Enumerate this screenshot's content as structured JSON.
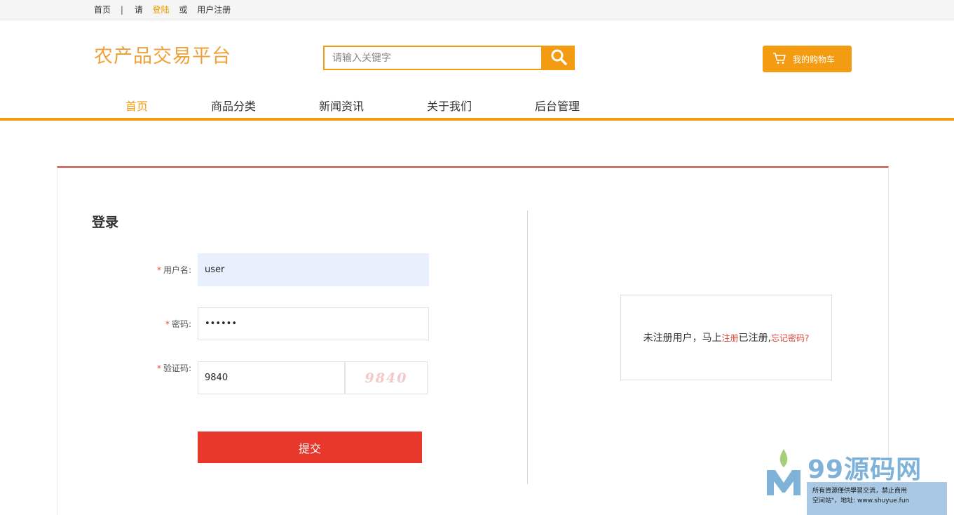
{
  "topbar": {
    "home": "首页",
    "separator": "|",
    "please": "请",
    "login": "登陆",
    "or": "或",
    "register": "用户注册"
  },
  "header": {
    "logo": "农产品交易平台",
    "search_placeholder": "请输入关键字",
    "cart_label": "我的购物车"
  },
  "nav": {
    "items": [
      {
        "label": "首页",
        "active": true
      },
      {
        "label": "商品分类",
        "active": false
      },
      {
        "label": "新闻资讯",
        "active": false
      },
      {
        "label": "关于我们",
        "active": false
      },
      {
        "label": "后台管理",
        "active": false
      }
    ]
  },
  "login": {
    "title": "登录",
    "required_mark": "*",
    "username_label": "用户名:",
    "username_value": "user",
    "password_label": "密码:",
    "password_value": "••••••",
    "captcha_label": "验证码:",
    "captcha_value": "9840",
    "captcha_image_text": "9840",
    "submit_label": "提交"
  },
  "info": {
    "text_before": "未注册用户，马上",
    "register_link": "注册",
    "text_middle": " 已注册,",
    "forgot_link": "忘记密码?"
  },
  "watermark": {
    "brand": "99源码网",
    "line1": "所有資源僅供學習交流，禁止商用",
    "line2": "空间站\"，地址: www.shuyue.fun"
  },
  "colors": {
    "accent": "#f39c12",
    "danger": "#e8382b",
    "panel_border": "#d9453a"
  }
}
